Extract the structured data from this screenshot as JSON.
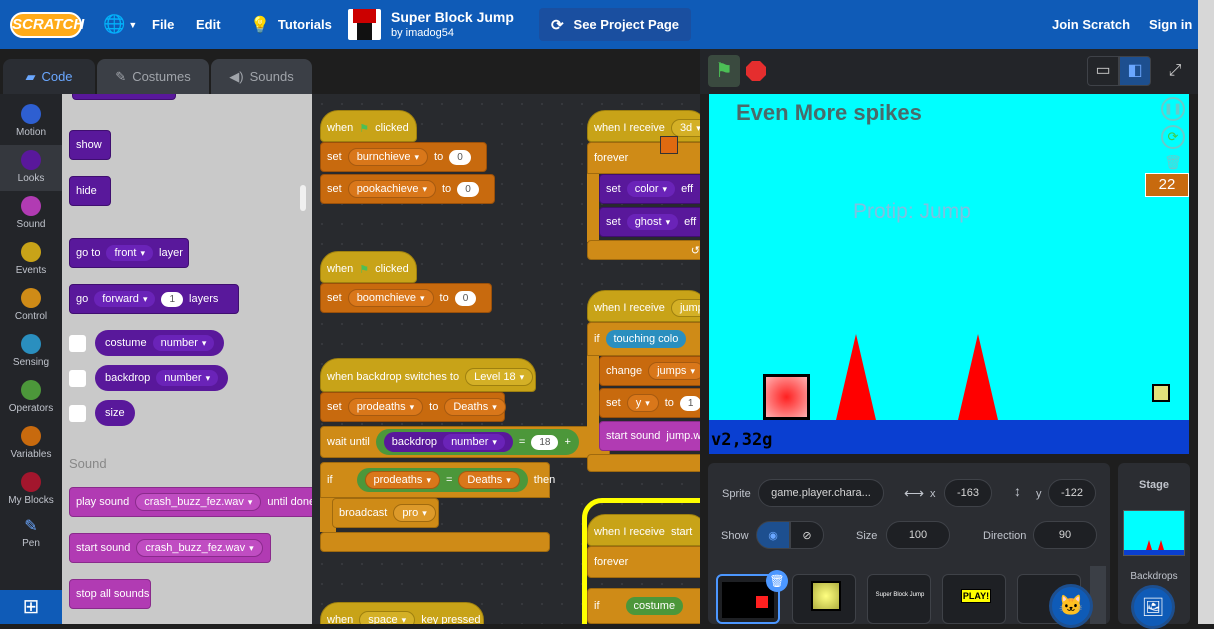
{
  "menu": {
    "logo": "SCRATCH",
    "file": "File",
    "edit": "Edit",
    "tutorials": "Tutorials",
    "join": "Join Scratch",
    "signin": "Sign in"
  },
  "project": {
    "title": "Super Block Jump",
    "author": "by imadog54",
    "see_page": "See Project Page"
  },
  "tabs": {
    "code": "Code",
    "costumes": "Costumes",
    "sounds": "Sounds"
  },
  "categories": [
    {
      "label": "Motion",
      "color": "#2e5fd1"
    },
    {
      "label": "Looks",
      "color": "#59189b"
    },
    {
      "label": "Sound",
      "color": "#b13bb3"
    },
    {
      "label": "Events",
      "color": "#c8a318"
    },
    {
      "label": "Control",
      "color": "#cf8b17"
    },
    {
      "label": "Sensing",
      "color": "#2a8fbf"
    },
    {
      "label": "Operators",
      "color": "#4c973a"
    },
    {
      "label": "Variables",
      "color": "#c86a0e"
    },
    {
      "label": "My Blocks",
      "color": "#a3162d"
    },
    {
      "label": "Pen",
      "color": ""
    }
  ],
  "palette": {
    "show": "show",
    "hide": "hide",
    "goto_a": "go to",
    "goto_dd": "front",
    "goto_b": "layer",
    "go_a": "go",
    "go_dd": "forward",
    "go_num": "1",
    "go_b": "layers",
    "costume": "costume",
    "costume_dd": "number",
    "backdrop": "backdrop",
    "backdrop_dd": "number",
    "size": "size",
    "sound_header": "Sound",
    "play_a": "play sound",
    "play_dd": "crash_buzz_fez.wav",
    "play_b": "until done",
    "start_a": "start sound",
    "start_dd": "crash_buzz_fez.wav",
    "stop": "stop all sounds"
  },
  "scripts": {
    "when_a": "when",
    "clicked": "clicked",
    "set": "set",
    "to": "to",
    "burn": "burnchieve",
    "pooka": "pookachieve",
    "boom": "boomchieve",
    "zero": "0",
    "bd_switch": "when backdrop switches to",
    "level": "Level 18",
    "prodeaths": "prodeaths",
    "deaths": "Deaths",
    "wait_until": "wait until",
    "bd": "backdrop",
    "bd_num": "number",
    "eq": "=",
    "eighteen": "18",
    "plus": "+",
    "if": "if",
    "then": "then",
    "broadcast": "broadcast",
    "pro": "pro",
    "when_recv": "when I receive",
    "recv1": "3d",
    "recv2": "jump",
    "recv3": "start",
    "forever": "forever",
    "color": "color",
    "ghost": "ghost",
    "eff": "eff",
    "touching": "touching colo",
    "change": "change",
    "jumps": "jumps",
    "y": "y",
    "one": "1",
    "start_sound": "start sound",
    "jump_wav": "jump.w",
    "when_key": "when",
    "space": "space",
    "key_pressed": "key pressed",
    "costume": "costume"
  },
  "stage": {
    "title": "Even More spikes",
    "protip": "Protip: Jump",
    "version": "v2,32g",
    "counter": "22"
  },
  "sprite": {
    "label": "Sprite",
    "name": "game.player.chara...",
    "x_label": "x",
    "x": "-163",
    "y_label": "y",
    "y": "-122",
    "show_label": "Show",
    "size_label": "Size",
    "size": "100",
    "dir_label": "Direction",
    "dir": "90",
    "thumb3_text": "Super Block Jump",
    "thumb4_text": "PLAY!"
  },
  "stage_pane": {
    "title": "Stage",
    "backdrops": "Backdrops"
  },
  "colors": {
    "menubar": "#0f5bb7",
    "stage_bg": "#00ffff",
    "spike": "#ff0000",
    "ground": "#0a3fd1",
    "player": "#ff2020"
  }
}
